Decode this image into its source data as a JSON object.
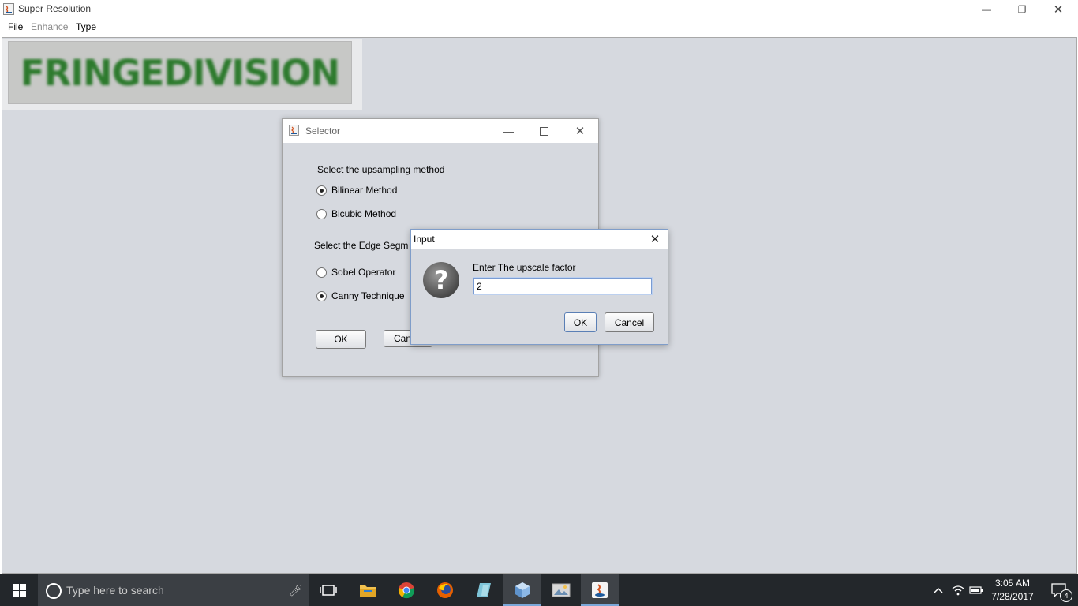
{
  "window": {
    "title": "Super Resolution",
    "controls": {
      "minimize": "—",
      "restore": "❐",
      "close": "✕"
    }
  },
  "menubar": {
    "items": [
      {
        "label": "File",
        "enabled": true
      },
      {
        "label": "Enhance",
        "enabled": false
      },
      {
        "label": "Type",
        "enabled": true
      }
    ]
  },
  "image_panel": {
    "logo_text": "FRINGEDIVISION",
    "logo_color": "#2d7a2d"
  },
  "selector_dialog": {
    "title": "Selector",
    "upsampling_label": "Select the upsampling method",
    "upsampling_options": [
      {
        "label": "Bilinear Method",
        "selected": true
      },
      {
        "label": "Bicubic Method",
        "selected": false
      }
    ],
    "edge_label": "Select the Edge Segm",
    "edge_options": [
      {
        "label": "Sobel Operator",
        "selected": false
      },
      {
        "label": "Canny Technique",
        "selected": true
      }
    ],
    "ok_label": "OK",
    "cancel_label": "Can"
  },
  "input_dialog": {
    "title": "Input",
    "prompt": "Enter The upscale factor",
    "value": "2",
    "icon": "question-icon",
    "ok_label": "OK",
    "cancel_label": "Cancel"
  },
  "taskbar": {
    "search_placeholder": "Type here to search",
    "pinned": [
      "task-view-icon",
      "file-explorer-icon",
      "chrome-icon",
      "firefox-icon",
      "app-icon",
      "virtualbox-icon",
      "image-viewer-icon",
      "java-icon"
    ],
    "clock_time": "3:05 AM",
    "clock_date": "7/28/2017",
    "notification_count": "4"
  },
  "colors": {
    "content_bg": "#d6d9df",
    "taskbar_bg": "#23272b",
    "accent": "#7aa7d8"
  }
}
